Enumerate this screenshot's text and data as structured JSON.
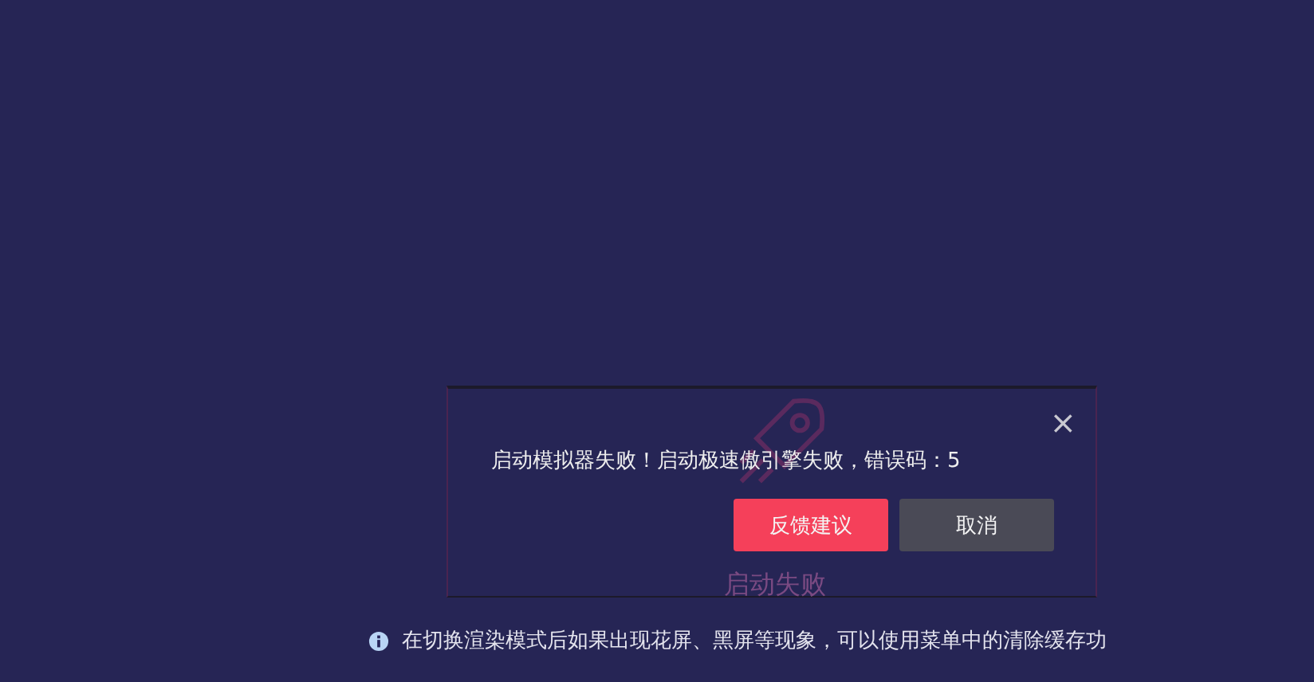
{
  "dialog": {
    "message": "启动模拟器失败！启动极速傲引擎失败，错误码：5",
    "close": "×",
    "buttons": [
      {
        "label": "反馈建议",
        "kind": "primary"
      },
      {
        "label": "取消",
        "kind": "secondary"
      }
    ],
    "background_label": "启动失败"
  },
  "notice": {
    "text": "在切换渲染模式后如果出现花屏、黑屏等现象，可以使用菜单中的清除缓存功"
  }
}
